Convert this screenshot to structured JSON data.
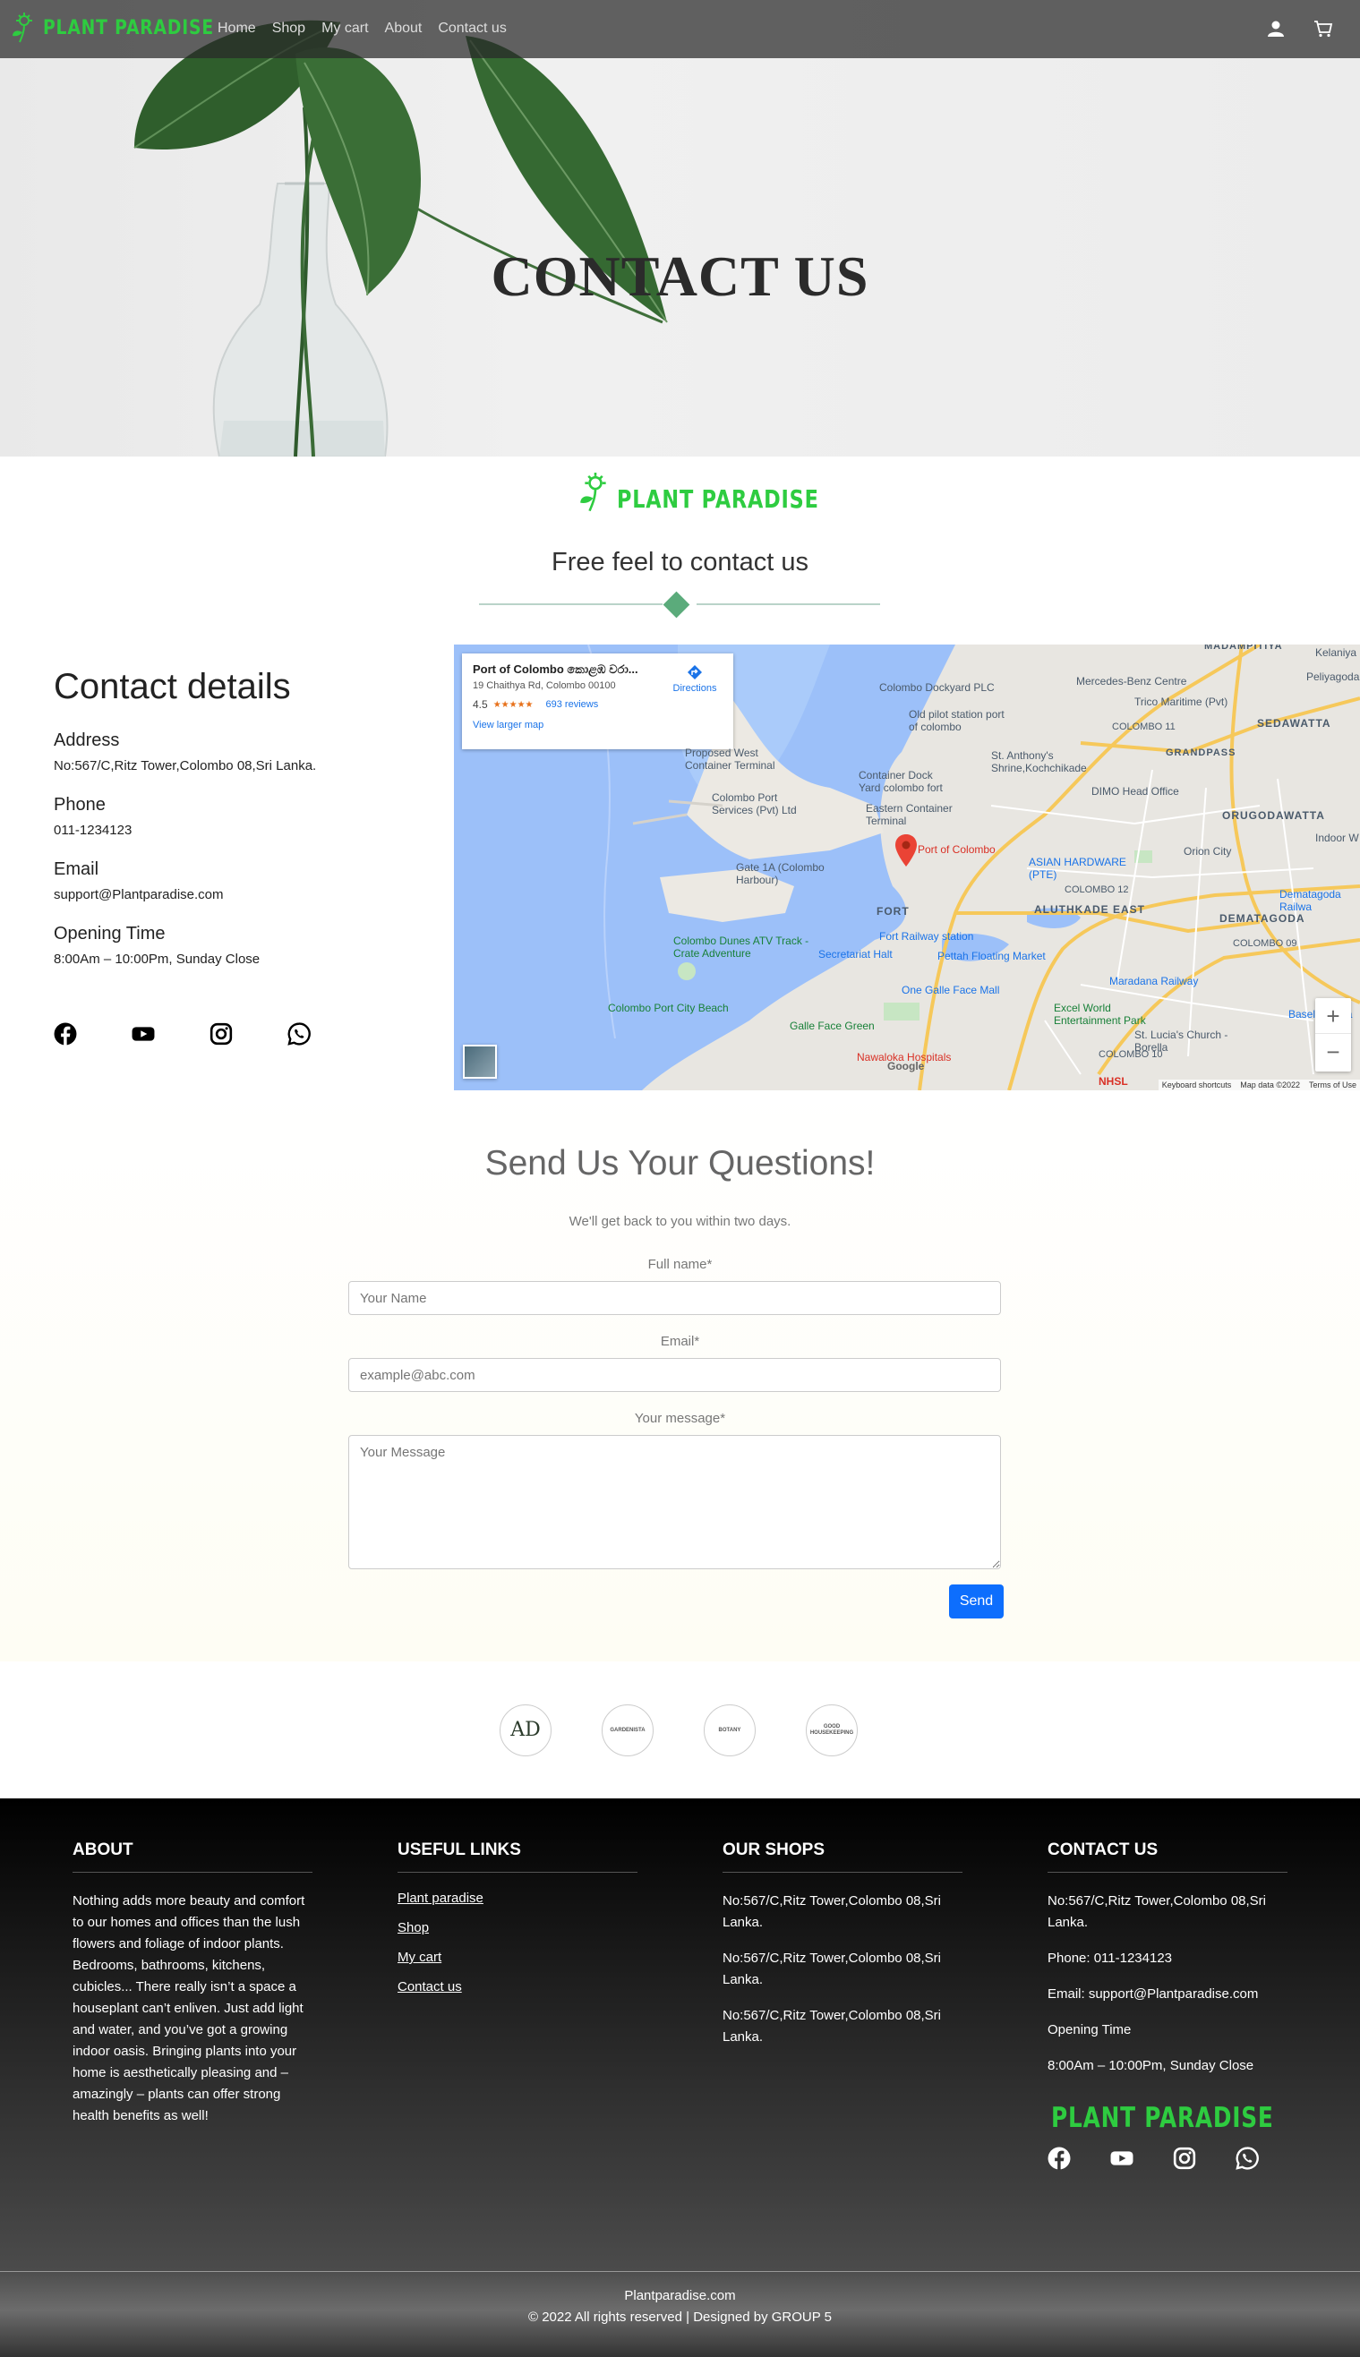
{
  "brand": {
    "name": "PLANT PARADISE",
    "color": "#2ecc40"
  },
  "nav": {
    "items": [
      {
        "label": "Home"
      },
      {
        "label": "Shop"
      },
      {
        "label": "My cart"
      },
      {
        "label": "About"
      },
      {
        "label": "Contact us"
      }
    ],
    "icons": [
      "user-icon",
      "cart-icon"
    ]
  },
  "hero": {
    "title": "CONTACT US"
  },
  "intro": {
    "subtitle": "Free feel to contact us",
    "accent": "#5bab7b"
  },
  "details": {
    "heading": "Contact details",
    "address_label": "Address",
    "address": "No:567/C,Ritz Tower,Colombo 08,Sri Lanka.",
    "phone_label": "Phone",
    "phone": "011-1234123",
    "email_label": "Email",
    "email": "support@Plantparadise.com",
    "hours_label": "Opening Time",
    "hours": "8:00Am – 10:00Pm, Sunday Close",
    "socials": [
      "facebook-icon",
      "youtube-icon",
      "instagram-icon",
      "whatsapp-icon"
    ]
  },
  "map": {
    "place": "Port of Colombo කොළඹ වරා...",
    "address": "19 Chaithya Rd, Colombo 00100",
    "rating": "4.5",
    "stars": "★★★★★",
    "reviews": "693 reviews",
    "directions": "Directions",
    "larger_map": "View larger map",
    "pin_label": "Port of Colombo",
    "labels": [
      "Colombo Dockyard PLC",
      "Old pilot station port of colombo",
      "Proposed West Container Terminal",
      "Colombo Port Services (Pvt) Ltd",
      "Container Dock Yard colombo fort",
      "Eastern Container Terminal",
      "Gate 1A (Colombo Harbour)",
      "FORT",
      "Secretariat Halt",
      "Fort Railway station",
      "Pettah Floating Market",
      "Colombo Dunes ATV Track - Crate Adventure",
      "Colombo Port City Beach",
      "One Galle Face Mall",
      "Galle Face Green",
      "Nawaloka Hospitals",
      "ASIAN HARDWARE (PTE)",
      "ALUTHKADE EAST",
      "DEMATAGODA",
      "ORUGODAWATTA",
      "SEDAWATTA",
      "Mercedes-Benz Centre",
      "Trico Maritime (Pvt)",
      "St. Anthony's Shrine,Kochchikade",
      "DIMO Head Office",
      "Maradana Railway",
      "Excel World Entertainment Park",
      "St. Lucia's Church - Borella",
      "Orion City",
      "COLOMBO 12",
      "COLOMBO 11",
      "COLOMBO 09",
      "COLOMBO 10",
      "GRANDPASS",
      "Baseline Roa",
      "Dematagoda Railwa",
      "Kelaniya",
      "Peliyagoda",
      "Indoor W",
      "MADAMPITIYA",
      "NHSL",
      "Google"
    ],
    "footer_keys": "Keyboard shortcuts",
    "footer_data": "Map data ©2022",
    "footer_terms": "Terms of Use",
    "zoom_in": "+",
    "zoom_out": "−"
  },
  "questions": {
    "title": "Send Us Your Questions!",
    "subtitle": "We'll get back to you within two days.",
    "name_label": "Full name*",
    "name_placeholder": "Your Name",
    "email_label": "Email*",
    "email_placeholder": "example@abc.com",
    "message_label": "Your message*",
    "message_placeholder": "Your Message",
    "send": "Send"
  },
  "partners": [
    {
      "text": "AD"
    },
    {
      "text": "GARDENISTA"
    },
    {
      "text": "BOTANY"
    },
    {
      "text": "GOOD HOUSEKEEPING"
    }
  ],
  "footer": {
    "about_title": "ABOUT",
    "about_text": "Nothing adds more beauty and comfort to our homes and offices than the lush flowers and foliage of indoor plants. Bedrooms, bathrooms, kitchens, cubicles... There really isn’t a space a houseplant can’t enliven. Just add light and water, and you’ve got a growing indoor oasis. Bringing plants into your home is aesthetically pleasing and – amazingly – plants can offer strong health benefits as well!",
    "links_title": "USEFUL LINKS",
    "links": [
      "Plant paradise",
      "Shop",
      "My cart",
      "Contact us"
    ],
    "shops_title": "OUR SHOPS",
    "shops": [
      "No:567/C,Ritz Tower,Colombo 08,Sri Lanka.",
      "No:567/C,Ritz Tower,Colombo 08,Sri Lanka.",
      "No:567/C,Ritz Tower,Colombo 08,Sri Lanka."
    ],
    "contact_title": "CONTACT US",
    "contact_address": "No:567/C,Ritz Tower,Colombo 08,Sri Lanka.",
    "contact_phone": "Phone: 011-1234123",
    "contact_email": "Email: support@Plantparadise.com",
    "contact_hours_label": "Opening Time",
    "contact_hours": "8:00Am – 10:00Pm, Sunday Close",
    "socials": [
      "facebook-icon",
      "youtube-icon",
      "instagram-icon",
      "whatsapp-icon"
    ]
  },
  "copyright": {
    "site": "Plantparadise.com",
    "text": "© 2022 All rights reserved | Designed by GROUP 5"
  }
}
